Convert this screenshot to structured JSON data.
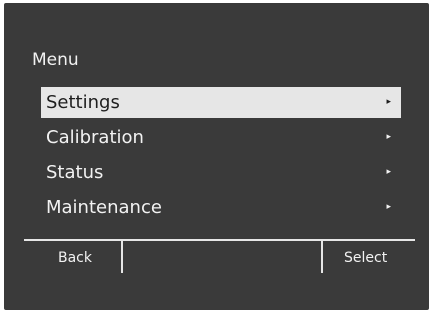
{
  "menu": {
    "title": "Menu",
    "items": [
      {
        "label": "Settings",
        "arrow": "▸",
        "selected": true
      },
      {
        "label": "Calibration",
        "arrow": "▸",
        "selected": false
      },
      {
        "label": "Status",
        "arrow": "▸",
        "selected": false
      },
      {
        "label": "Maintenance",
        "arrow": "▸",
        "selected": false
      }
    ]
  },
  "softkeys": {
    "left_label": "Back",
    "right_label": "Select"
  },
  "colors": {
    "background": "#3a3a3a",
    "text": "#f2f2f2",
    "highlight_bg": "#e6e6e6",
    "highlight_text": "#1e1e1e"
  }
}
